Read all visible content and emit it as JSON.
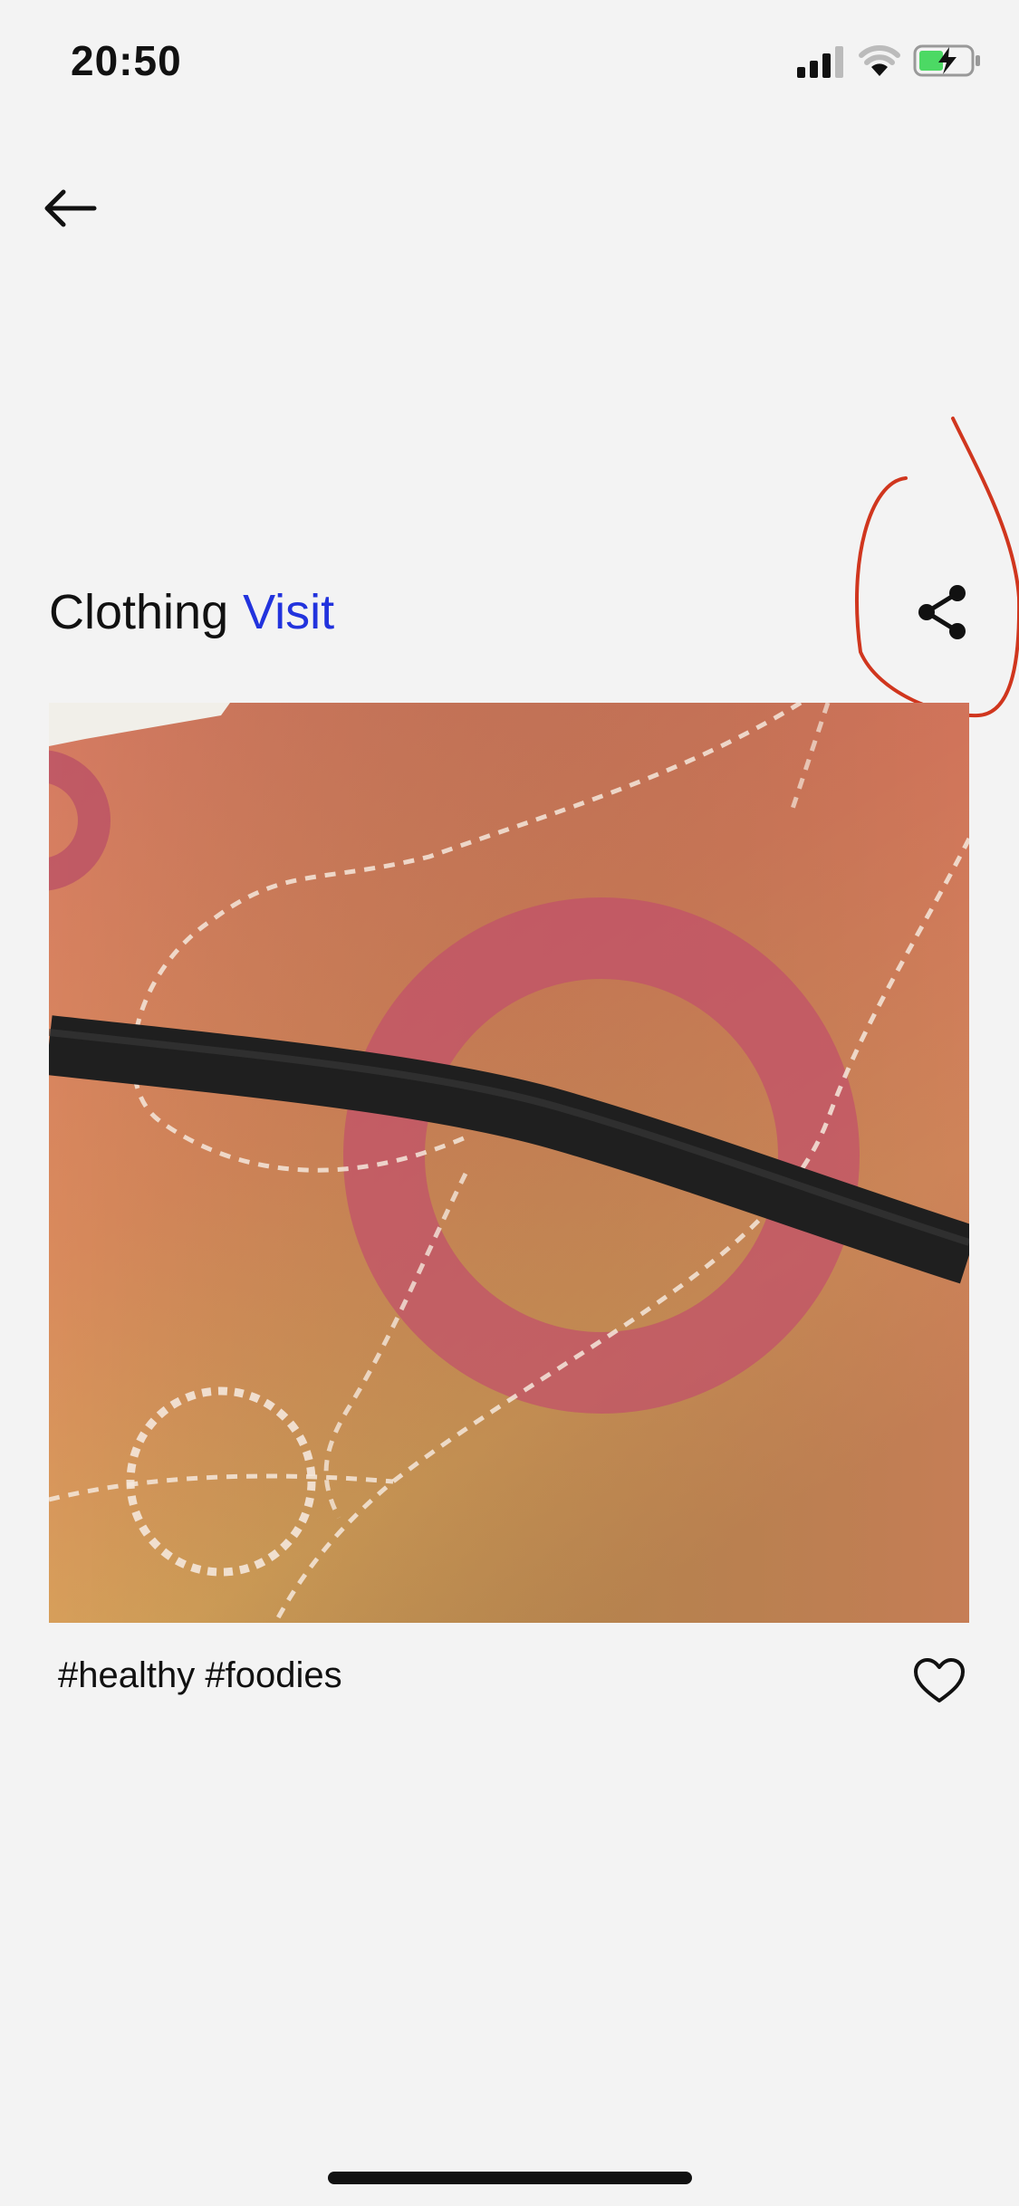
{
  "status_bar": {
    "time": "20:50",
    "battery_icon": "battery-charging-icon",
    "battery_color": "#4cd964"
  },
  "navigation": {
    "back_icon": "arrow-left-icon"
  },
  "post": {
    "category": "Clothing",
    "visit_label": "Visit",
    "visit_color": "#2233dd",
    "share_icon": "share-icon",
    "tags": "#healthy #foodies",
    "like_icon": "heart-outline-icon"
  },
  "annotation": {
    "color": "#d0361e"
  }
}
